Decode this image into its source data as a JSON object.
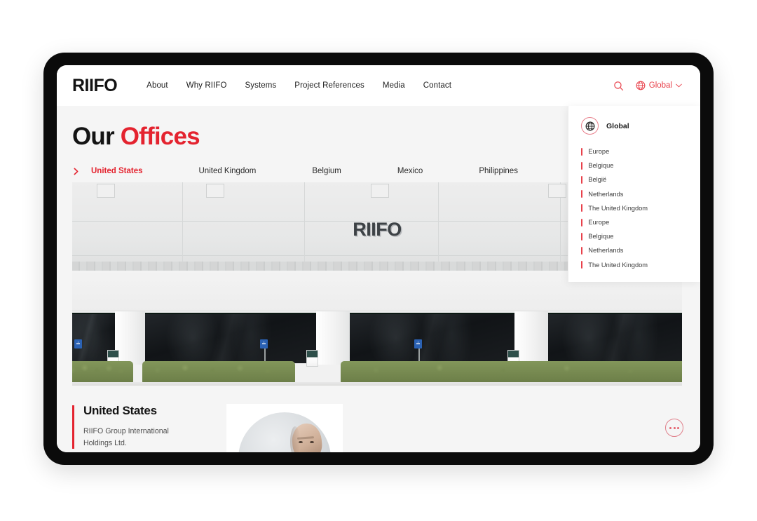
{
  "brand": {
    "name": "RIIFO"
  },
  "header": {
    "nav": [
      {
        "label": "About"
      },
      {
        "label": "Why RIIFO"
      },
      {
        "label": "Systems"
      },
      {
        "label": "Project References"
      },
      {
        "label": "Media"
      },
      {
        "label": "Contact"
      }
    ],
    "search_icon": "search-icon",
    "language": {
      "icon": "globe-icon",
      "label": "Global",
      "caret": "chevron-down-icon"
    }
  },
  "language_panel": {
    "icon": "globe-icon",
    "title": "Global",
    "items": [
      {
        "label": "Europe"
      },
      {
        "label": "Belgique"
      },
      {
        "label": "België"
      },
      {
        "label": "Netherlands"
      },
      {
        "label": "The United Kingdom"
      },
      {
        "label": "Europe"
      },
      {
        "label": "Belgique"
      },
      {
        "label": "Netherlands"
      },
      {
        "label": "The United Kingdom"
      }
    ]
  },
  "page": {
    "title_plain": "Our ",
    "title_accent": "Offices"
  },
  "office_tabs": {
    "arrow_icon": "chevron-right-icon",
    "items": [
      {
        "label": "United States",
        "active": true
      },
      {
        "label": "United Kingdom",
        "active": false
      },
      {
        "label": "Belgium",
        "active": false
      },
      {
        "label": "Mexico",
        "active": false
      },
      {
        "label": "Philippines",
        "active": false
      }
    ]
  },
  "hero": {
    "sign_text": "RIIFO",
    "alt": "RIIFO office building exterior"
  },
  "office_detail": {
    "country": "United States",
    "company": "RIIFO Group International Holdings Ltd.",
    "portrait_alt": "Office representative portrait"
  },
  "more_button": {
    "icon": "ellipsis-icon",
    "label": "More"
  },
  "colors": {
    "accent_red": "#e4232f",
    "link_red": "#e8414b",
    "page_bg": "#f5f5f5",
    "header_bg": "#ffffff",
    "frame_black": "#0b0b0b",
    "text_dark": "#141414"
  }
}
